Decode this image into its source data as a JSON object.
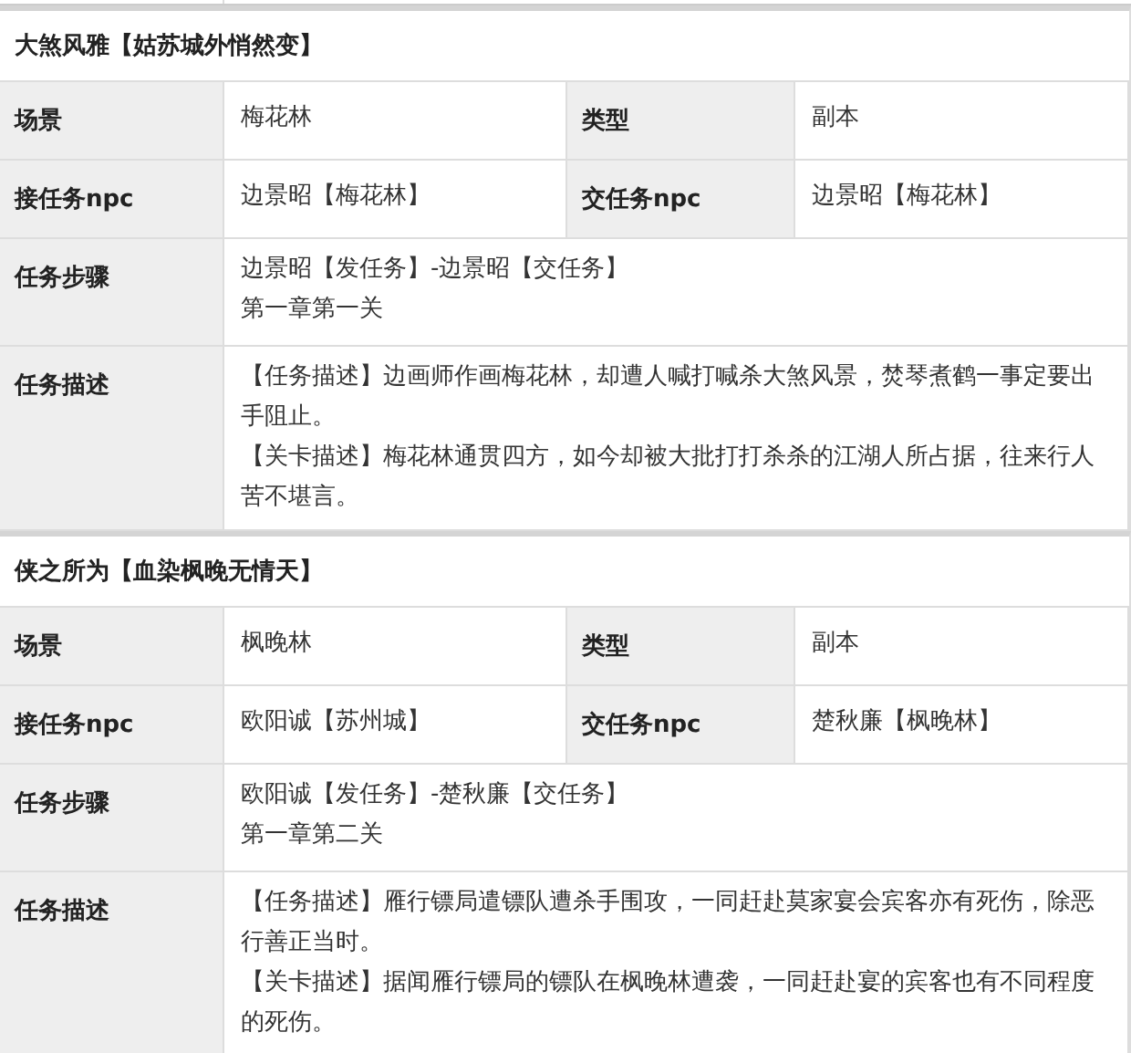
{
  "quests": [
    {
      "title": "大煞风雅【姑苏城外悄然变】",
      "rows": [
        {
          "kind": "pair",
          "cells": [
            {
              "label": "场景",
              "value": "梅花林"
            },
            {
              "label": "类型",
              "value": "副本"
            }
          ]
        },
        {
          "kind": "pair",
          "cells": [
            {
              "label": "接任务npc",
              "value": "边景昭【梅花林】"
            },
            {
              "label": "交任务npc",
              "value": "边景昭【梅花林】"
            }
          ]
        },
        {
          "kind": "wide",
          "label": "任务步骤",
          "lines": [
            "边景昭【发任务】-边景昭【交任务】",
            "第一章第一关"
          ]
        },
        {
          "kind": "wide",
          "label": "任务描述",
          "lines": [
            "【任务描述】边画师作画梅花林，却遭人喊打喊杀大煞风景，焚琴煮鹤一事定要出手阻止。",
            "【关卡描述】梅花林通贯四方，如今却被大批打打杀杀的江湖人所占据，往来行人苦不堪言。"
          ]
        }
      ]
    },
    {
      "title": "侠之所为【血染枫晚无情天】",
      "rows": [
        {
          "kind": "pair",
          "cells": [
            {
              "label": "场景",
              "value": "枫晚林"
            },
            {
              "label": "类型",
              "value": "副本"
            }
          ]
        },
        {
          "kind": "pair",
          "cells": [
            {
              "label": "接任务npc",
              "value": "欧阳诚【苏州城】"
            },
            {
              "label": "交任务npc",
              "value": "楚秋廉【枫晚林】"
            }
          ]
        },
        {
          "kind": "wide",
          "label": "任务步骤",
          "lines": [
            "欧阳诚【发任务】-楚秋廉【交任务】",
            "第一章第二关"
          ]
        },
        {
          "kind": "wide",
          "label": "任务描述",
          "lines": [
            "【任务描述】雁行镖局遣镖队遭杀手围攻，一同赶赴莫家宴会宾客亦有死伤，除恶行善正当时。",
            "【关卡描述】据闻雁行镖局的镖队在枫晚林遭袭，一同赶赴宴的宾客也有不同程度的死伤。"
          ]
        }
      ]
    }
  ]
}
